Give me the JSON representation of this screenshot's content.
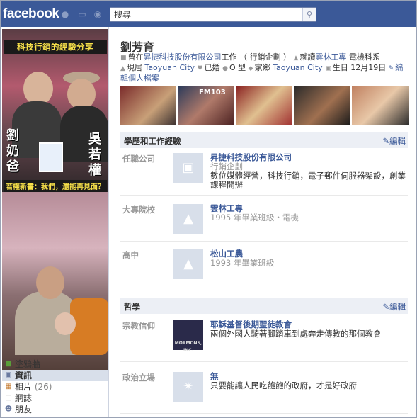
{
  "topbar": {
    "logo": "facebook",
    "search_value": "搜尋"
  },
  "profile": {
    "name": "劉芳育",
    "summary": {
      "worked_prefix": "曾在",
      "worked_company": "昇捷科技股份有限公司",
      "worked_suffix": "工作 （ 行銷企劃 ）",
      "studied_prefix": "就讀",
      "studied_school": "雲林工專",
      "studied_dept": "電機科系",
      "lives_prefix": "現居",
      "lives_city": "Taoyuan City",
      "married": "已婚",
      "blood": "O 型",
      "hometown_prefix": "家鄉",
      "hometown_city": "Taoyuan City",
      "birthday": "生日 12月19日",
      "edit_link": "編輯個人檔案"
    },
    "photo_overlay_text": "FM103"
  },
  "profile_picture": {
    "title": "科技行銷的經驗分享",
    "name_left": "劉奶爸",
    "name_right": "吳若權",
    "caption": "若權新書：我們，還能再見面？"
  },
  "left_nav": [
    {
      "icon": "wall-icon",
      "label": "塗鴉牆",
      "count": ""
    },
    {
      "icon": "info-icon",
      "label": "資訊",
      "count": "",
      "active": true
    },
    {
      "icon": "photos-icon",
      "label": "相片",
      "count": "(26)"
    },
    {
      "icon": "notes-icon",
      "label": "網誌",
      "count": ""
    },
    {
      "icon": "friends-icon",
      "label": "朋友",
      "count": ""
    }
  ],
  "education_work": {
    "header": "學歷和工作經驗",
    "edit": "編輯",
    "rows": [
      {
        "label": "任職公司",
        "title": "昇捷科技股份有限公司",
        "sub": "行銷企劃",
        "desc": "數位媒體經營，科技行銷，電子郵件伺服器架設，創業課程開辦"
      },
      {
        "label": "大專院校",
        "title": "雲林工專",
        "sub": "1995 年畢業班級・電機",
        "desc": ""
      },
      {
        "label": "高中",
        "title": "松山工農",
        "sub": "1993 年畢業班級",
        "desc": ""
      }
    ]
  },
  "philosophy": {
    "header": "哲學",
    "edit": "編輯",
    "rows": [
      {
        "label": "宗教信仰",
        "title": "耶穌基督後期聖徒教會",
        "sub": "",
        "desc": "兩個外國人騎著腳踏車到處奔走傳教的那個教會",
        "thumb_text": "MORMONS, INC."
      },
      {
        "label": "政治立場",
        "title": "無",
        "sub": "",
        "desc": "只要能讓人民吃飽飽的政府，才是好政府"
      }
    ]
  },
  "colors": {
    "brand": "#3b5998",
    "header_bg": "#eceff5",
    "link": "#3b5998",
    "muted": "#999999"
  }
}
